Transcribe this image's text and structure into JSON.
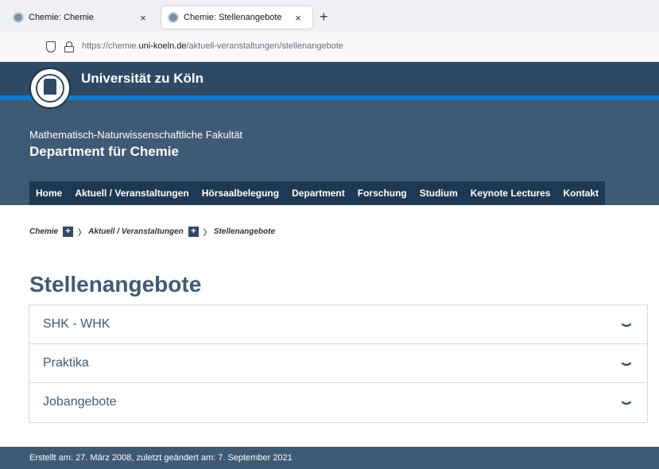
{
  "browser": {
    "tabs": [
      {
        "title": "Chemie: Chemie",
        "active": false
      },
      {
        "title": "Chemie: Stellenangebote",
        "active": true
      }
    ],
    "close_glyph": "×",
    "new_tab_glyph": "+",
    "url": {
      "prefix": "https://chemie.",
      "domain": "uni-koeln.de",
      "path": "/aktuell-veranstaltungen/stellenangebote"
    }
  },
  "header": {
    "university": "Universität zu Köln",
    "faculty": "Mathematisch-Naturwissenschaftliche Fakultät",
    "department": "Department für Chemie"
  },
  "nav": {
    "items": [
      {
        "label": "Home"
      },
      {
        "label": "Aktuell / Veranstaltungen"
      },
      {
        "label": "Hörsaalbelegung"
      },
      {
        "label": "Department"
      },
      {
        "label": "Forschung"
      },
      {
        "label": "Studium"
      },
      {
        "label": "Keynote Lectures"
      },
      {
        "label": "Kontakt"
      }
    ]
  },
  "breadcrumb": {
    "items": [
      "Chemie",
      "Aktuell / Veranstaltungen",
      "Stellenangebote"
    ],
    "expand_glyph": "+",
    "separator": "〉"
  },
  "page": {
    "title": "Stellenangebote"
  },
  "accordion": {
    "items": [
      {
        "label": "SHK - WHK"
      },
      {
        "label": "Praktika"
      },
      {
        "label": "Jobangebote"
      }
    ]
  },
  "footer": {
    "text": "Erstellt am: 27. März 2008, zuletzt geändert am:  7. September 2021"
  },
  "colors": {
    "header_dark": "#2f4a65",
    "header_band": "#3f5a75",
    "accent_blue": "#0f7ccd",
    "nav_bg": "#1e3954"
  }
}
